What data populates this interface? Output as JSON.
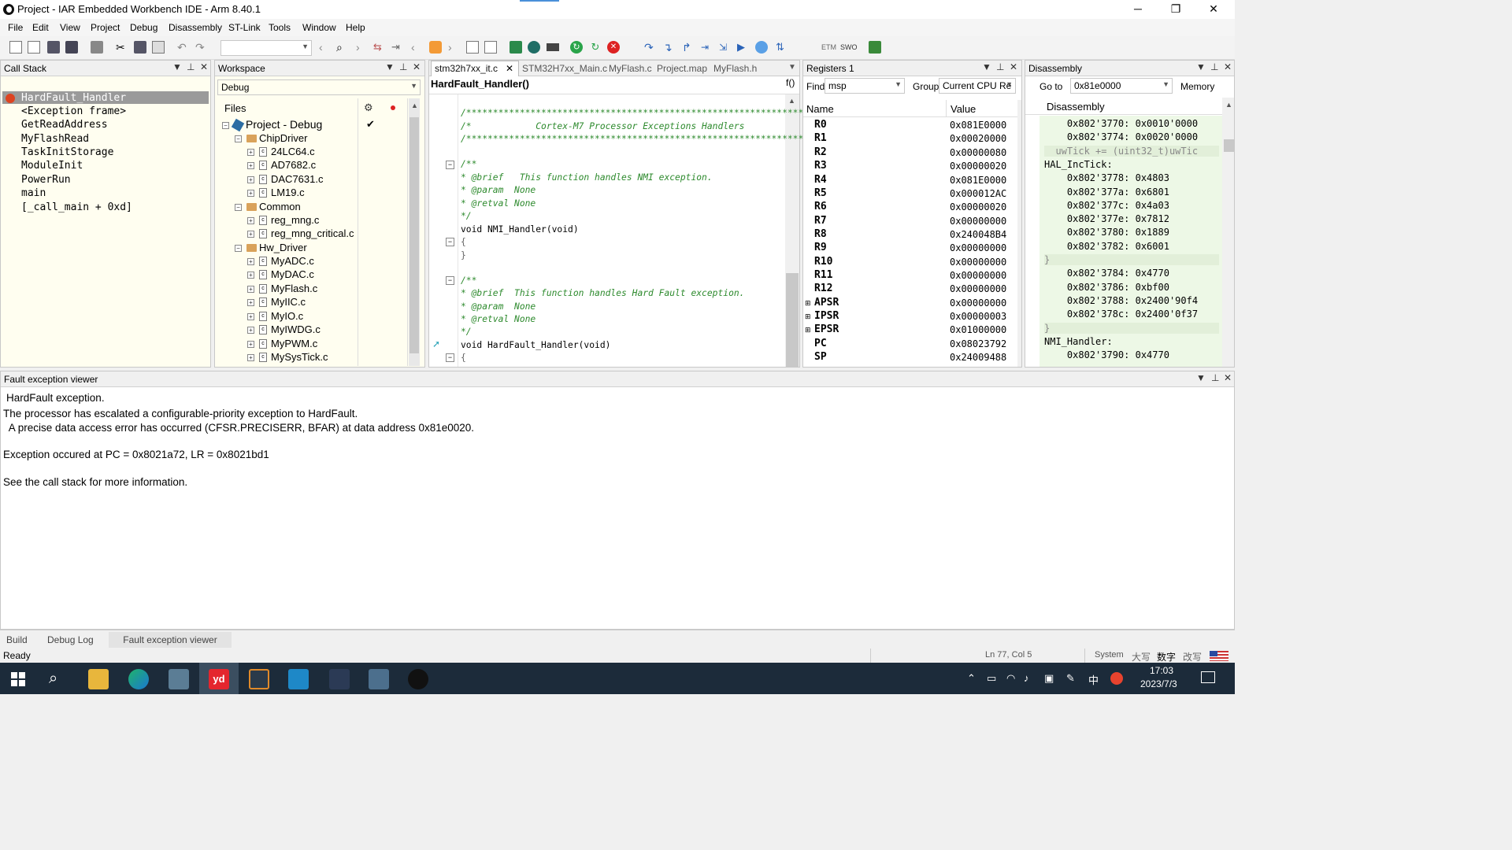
{
  "window": {
    "title": "Project - IAR Embedded Workbench IDE - Arm 8.40.1",
    "minimize": "─",
    "restore": "❐",
    "close": "✕"
  },
  "menu": [
    "File",
    "Edit",
    "View",
    "Project",
    "Debug",
    "Disassembly",
    "ST-Link",
    "Tools",
    "Window",
    "Help"
  ],
  "call_stack": {
    "title": "Call Stack",
    "items": [
      "HardFault_Handler",
      "<Exception frame>",
      "GetReadAddress",
      "MyFlashRead",
      "TaskInitStorage",
      "ModuleInit",
      "PowerRun",
      "main",
      "[_call_main + 0xd]"
    ]
  },
  "workspace": {
    "title": "Workspace",
    "config": "Debug",
    "files_label": "Files",
    "project": "Project - Debug",
    "groups": [
      {
        "name": "ChipDriver",
        "files": [
          "24LC64.c",
          "AD7682.c",
          "DAC7631.c",
          "LM19.c"
        ]
      },
      {
        "name": "Common",
        "files": [
          "reg_mng.c",
          "reg_mng_critical.c"
        ]
      },
      {
        "name": "Hw_Driver",
        "files": [
          "MyADC.c",
          "MyDAC.c",
          "MyFlash.c",
          "MyIIC.c",
          "MyIO.c",
          "MyIWDG.c",
          "MyPWM.c",
          "MySysTick.c"
        ]
      }
    ]
  },
  "editor": {
    "tabs": [
      "stm32h7xx_it.c",
      "STM32H7xx_Main.c",
      "MyFlash.c",
      "Project.map",
      "MyFlash.h"
    ],
    "function": "HardFault_Handler()",
    "fx": "f()",
    "lines": {
      "stars1": "/*****************************************************************",
      "title": "/*            Cortex-M7 Processor Exceptions Handlers",
      "stars2": "/*****************************************************************",
      "c1": "/**",
      "c2": "* @brief   This function handles NMI exception.",
      "c3": "* @param  None",
      "c4": "* @retval None",
      "c5": "*/",
      "f1": "void NMI_Handler(void)",
      "b1": "{",
      "b2": "}",
      "d1": "/**",
      "d2": "* @brief  This function handles Hard Fault exception.",
      "d3": "* @param  None",
      "d4": "* @retval None",
      "d5": "*/",
      "f2": "void HardFault_Handler(void)",
      "b3": "{"
    }
  },
  "registers": {
    "title": "Registers 1",
    "find_label": "Find:",
    "find_value": "msp",
    "group_label": "Group:",
    "group_value": "Current CPU Re",
    "col_name": "Name",
    "col_value": "Value",
    "rows": [
      {
        "name": "R0",
        "value": "0x081E0000"
      },
      {
        "name": "R1",
        "value": "0x00020000"
      },
      {
        "name": "R2",
        "value": "0x00000080"
      },
      {
        "name": "R3",
        "value": "0x00000020"
      },
      {
        "name": "R4",
        "value": "0x081E0000"
      },
      {
        "name": "R5",
        "value": "0x000012AC"
      },
      {
        "name": "R6",
        "value": "0x00000020"
      },
      {
        "name": "R7",
        "value": "0x00000000"
      },
      {
        "name": "R8",
        "value": "0x240048B4"
      },
      {
        "name": "R9",
        "value": "0x00000000"
      },
      {
        "name": "R10",
        "value": "0x00000000"
      },
      {
        "name": "R11",
        "value": "0x00000000"
      },
      {
        "name": "R12",
        "value": "0x00000000"
      },
      {
        "name": "APSR",
        "value": "0x00000000"
      },
      {
        "name": "IPSR",
        "value": "0x00000003"
      },
      {
        "name": "EPSR",
        "value": "0x01000000"
      },
      {
        "name": "PC",
        "value": "0x08023792"
      },
      {
        "name": "SP",
        "value": "0x24009488"
      }
    ]
  },
  "disassembly": {
    "title": "Disassembly",
    "goto_label": "Go to",
    "goto_value": "0x81e0000",
    "memory_label": "Memory",
    "header": "Disassembly",
    "rows": [
      {
        "t": "    0x802'3770: 0x0010'0000",
        "k": "addr"
      },
      {
        "t": "    0x802'3774: 0x0020'0000",
        "k": "addr"
      },
      {
        "t": "  uwTick += (uint32_t)uwTic",
        "k": "src"
      },
      {
        "t": "HAL_IncTick:",
        "k": "label"
      },
      {
        "t": "    0x802'3778: 0x4803",
        "k": "addr"
      },
      {
        "t": "    0x802'377a: 0x6801",
        "k": "addr"
      },
      {
        "t": "    0x802'377c: 0x4a03",
        "k": "addr"
      },
      {
        "t": "    0x802'377e: 0x7812",
        "k": "addr"
      },
      {
        "t": "    0x802'3780: 0x1889",
        "k": "addr"
      },
      {
        "t": "    0x802'3782: 0x6001",
        "k": "addr"
      },
      {
        "t": "}",
        "k": "src"
      },
      {
        "t": "    0x802'3784: 0x4770",
        "k": "addr"
      },
      {
        "t": "    0x802'3786: 0xbf00",
        "k": "addr"
      },
      {
        "t": "    0x802'3788: 0x2400'90f4",
        "k": "addr"
      },
      {
        "t": "    0x802'378c: 0x2400'0f37",
        "k": "addr"
      },
      {
        "t": "}",
        "k": "src"
      },
      {
        "t": "NMI_Handler:",
        "k": "label"
      },
      {
        "t": "    0x802'3790: 0x4770",
        "k": "addr"
      }
    ]
  },
  "fault": {
    "title": "Fault exception viewer",
    "lines": [
      "HardFault exception.",
      "The processor has escalated a configurable-priority exception to HardFault.",
      "  A precise data access error has occurred (CFSR.PRECISERR, BFAR) at data address 0x81e0020.",
      "",
      "Exception occured at PC = 0x8021a72, LR = 0x8021bd1",
      "",
      "See the call stack for more information."
    ]
  },
  "bottom_tabs": [
    "Build",
    "Debug Log",
    "Fault exception viewer"
  ],
  "status": {
    "left": "Ready",
    "position": "Ln 77, Col 5",
    "mode": "System",
    "ind1": "大写",
    "ind2": "数字",
    "ind3": "改写"
  },
  "taskbar": {
    "time": "17:03",
    "date": "2023/7/3",
    "ime": "中"
  }
}
